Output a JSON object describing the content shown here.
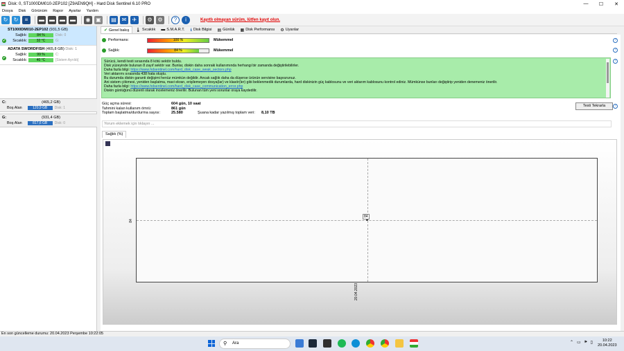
{
  "window": {
    "title": "Disk: 0, ST1000DM010-2EP102 [Z9AEN9QH]  -  Hard Disk Sentinel 6.10 PRO",
    "min": "—",
    "max": "☐",
    "close": "✕"
  },
  "menu": [
    "Dosya",
    "Disk",
    "Görünüm",
    "Rapor",
    "Ayarlar",
    "Yardım"
  ],
  "toolbar": {
    "unregistered": "Kayıtlı olmayan sürüm, lütfen kayıt olun."
  },
  "disks": [
    {
      "name": "ST1000DM010-2EP102",
      "size": "(931,5 GB)",
      "health_label": "Sağlık:",
      "health": "84 %",
      "health_note": "Disk: 0",
      "temp_label": "Sıcaklık:",
      "temp": "32 °C",
      "temp_note": "G:"
    },
    {
      "name": "ADATA SWORDFISH",
      "size": "(465,8 GB)",
      "size_note": "Disk: 1",
      "health_label": "Sağlık:",
      "health": "99 %",
      "health_note": "C:",
      "temp_label": "Sıcaklık:",
      "temp": "40 °C",
      "temp_note": "[Sistem Ayrıldı]"
    }
  ],
  "partitions": [
    {
      "letter": "C:",
      "size": "(465,2 GB)",
      "free_label": "Boş Alan",
      "free": "120,9 GB",
      "note": "Disk: 1"
    },
    {
      "letter": "G:",
      "size": "(931,4 GB)",
      "free_label": "Boş Alan",
      "free": "817,6 GB",
      "note": "Disk: 0"
    }
  ],
  "tabs": [
    {
      "label": "Genel bakış",
      "icon": "✔"
    },
    {
      "label": "Sıcaklık",
      "icon": "🌡"
    },
    {
      "label": "S.M.A.R.T.",
      "icon": "▬"
    },
    {
      "label": "Disk Bilgisi",
      "icon": "ℹ"
    },
    {
      "label": "Günlük",
      "icon": "▤"
    },
    {
      "label": "Disk Performansı",
      "icon": "▦"
    },
    {
      "label": "Uyarılar",
      "icon": "⚙"
    }
  ],
  "performance": {
    "label": "Performans:",
    "value": "100 %",
    "verdict": "Mükemmel",
    "level": 100
  },
  "health": {
    "label": "Sağlık:",
    "value": "84 %",
    "verdict": "Mükemmel",
    "level": 84
  },
  "info_lines": [
    "Sürücü, kendi testi sırasında 8 kötü sektör buldu.",
    "Disk yüzeyinde bulunan 8 zayıf sektör var. Bunlar, diskin daha sonraki kullanımında herhangi bir zamanda değiştirilebilirler.",
    {
      "text": "Daha fazla bilgi: ",
      "link": "https://www.hdsentinel.com/hard_disk_case_weak_sectors.php"
    },
    "Veri aktarımı sırasında 438 hata oluştu.",
    "Bu durumda diskin garanti değişimi henüz mümkün değildir. Ancak sağlık daha da düşerse ürünün servisine başvurunuz.",
    "Ani sistem çökmesi, yeniden başlatma, mavi ekran, erişilemeyen dosya(lar) ve klasör(ler) gibi beklenmedik durumlarda, hard diskinizin güç kablosunu ve veri aktarım kablosunu kontrol ediniz. Mümkünse bunları değiştirip yeniden denemeniz önerilir.",
    {
      "text": "Daha fazla bilgi: ",
      "link": "https://www.hdsentinel.com/hard_disk_case_communication_error.php"
    },
    "Diskin günlüğünü düzenli olarak incelemeniz önerilir. Bulunan tüm yeni sorunlar oraya kaydedilir."
  ],
  "stats": {
    "power_on_label": "Güç açma süresi:",
    "power_on": "604 gün, 10 saat",
    "remaining_label": "Tahmini kalan kullanım ömrü:",
    "remaining": "861 gün",
    "starts_label": "Toplam başlatma/durdurma sayısı:",
    "starts": "25.580",
    "written_label": "Şuana kadar yazılmış toplam veri:",
    "written": "8,10 TB"
  },
  "retest_button": "Testi Tekrarla",
  "comment_placeholder": "Yorum eklemek için tıklayın ...",
  "graph_tab": "Sağlık (%)",
  "chart_data": {
    "type": "line",
    "title": "",
    "xlabel": "",
    "ylabel": "",
    "series": [
      {
        "points": [
          {
            "x": "20.04.2023",
            "y": 84
          }
        ]
      }
    ],
    "x_ticks": [
      "20.04.2023"
    ],
    "y_ticks": [
      "84"
    ],
    "point_labels": [
      "84"
    ],
    "grid": true
  },
  "status_bar": "En son güncelleme durumu: 20.04.2023 Perşembe 10:22:05",
  "taskbar": {
    "search": "Ara",
    "time": "10:22",
    "date": "20.04.2023"
  }
}
